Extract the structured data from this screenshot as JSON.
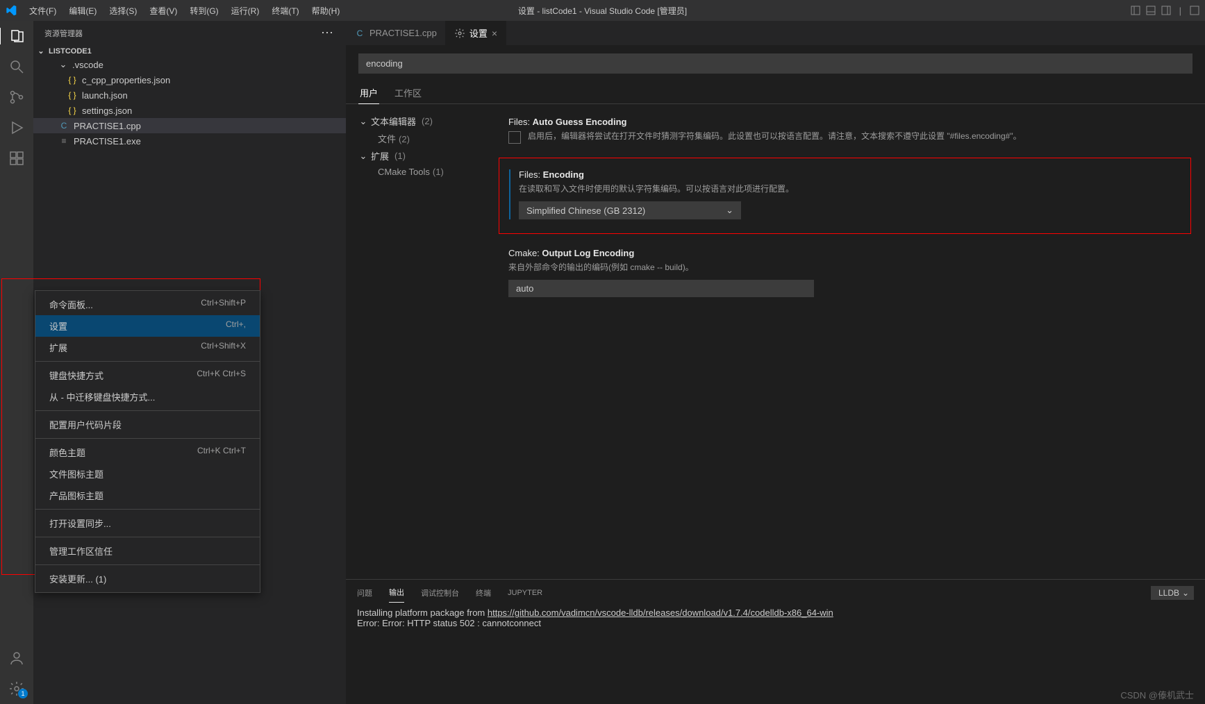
{
  "window": {
    "title": "设置 - listCode1 - Visual Studio Code [管理员]"
  },
  "menus": [
    "文件(F)",
    "编辑(E)",
    "选择(S)",
    "查看(V)",
    "转到(G)",
    "运行(R)",
    "终端(T)",
    "帮助(H)"
  ],
  "sidebar": {
    "title": "资源管理器",
    "project": "LISTCODE1",
    "tree": [
      {
        "label": ".vscode",
        "type": "folder",
        "depth": 1
      },
      {
        "label": "c_cpp_properties.json",
        "type": "json",
        "depth": 2
      },
      {
        "label": "launch.json",
        "type": "json",
        "depth": 2
      },
      {
        "label": "settings.json",
        "type": "json",
        "depth": 2
      },
      {
        "label": "PRACTISE1.cpp",
        "type": "cpp",
        "depth": 1,
        "selected": true
      },
      {
        "label": "PRACTISE1.exe",
        "type": "exe",
        "depth": 1
      }
    ]
  },
  "context_menu": [
    {
      "label": "命令面板...",
      "shortcut": "Ctrl+Shift+P"
    },
    {
      "label": "设置",
      "shortcut": "Ctrl+,",
      "hovered": true
    },
    {
      "label": "扩展",
      "shortcut": "Ctrl+Shift+X"
    },
    {
      "sep": true
    },
    {
      "label": "键盘快捷方式",
      "shortcut": "Ctrl+K Ctrl+S"
    },
    {
      "label": "从 - 中迁移键盘快捷方式..."
    },
    {
      "sep": true
    },
    {
      "label": "配置用户代码片段"
    },
    {
      "sep": true
    },
    {
      "label": "颜色主题",
      "shortcut": "Ctrl+K Ctrl+T"
    },
    {
      "label": "文件图标主题"
    },
    {
      "label": "产品图标主题"
    },
    {
      "sep": true
    },
    {
      "label": "打开设置同步..."
    },
    {
      "sep": true
    },
    {
      "label": "管理工作区信任"
    },
    {
      "sep": true
    },
    {
      "label": "安装更新... (1)"
    }
  ],
  "tabs": [
    {
      "icon": "cpp",
      "label": "PRACTISE1.cpp"
    },
    {
      "icon": "gear",
      "label": "设置",
      "active": true,
      "closable": true
    }
  ],
  "settings": {
    "search_value": "encoding",
    "scopes": {
      "user": "用户",
      "workspace": "工作区"
    },
    "toc": {
      "textEditor": {
        "label": "文本编辑器",
        "count": "(2)"
      },
      "files": {
        "label": "文件",
        "count": "(2)"
      },
      "extensions": {
        "label": "扩展",
        "count": "(1)"
      },
      "cmake": {
        "label": "CMake Tools",
        "count": "(1)"
      }
    },
    "items": {
      "autoGuess": {
        "prefix": "Files: ",
        "title": "Auto Guess Encoding",
        "desc": "启用后，编辑器将尝试在打开文件时猜测字符集编码。此设置也可以按语言配置。请注意，文本搜索不遵守此设置 \"#files.encoding#\"。"
      },
      "encoding": {
        "prefix": "Files: ",
        "title": "Encoding",
        "desc": "在读取和写入文件时使用的默认字符集编码。可以按语言对此项进行配置。",
        "value": "Simplified Chinese (GB 2312)"
      },
      "cmakeLog": {
        "prefix": "Cmake: ",
        "title": "Output Log Encoding",
        "desc": "来自外部命令的输出的编码(例如 cmake -- build)。",
        "value": "auto"
      }
    }
  },
  "panel": {
    "tabs": {
      "problems": "问题",
      "output": "输出",
      "debug": "调试控制台",
      "terminal": "终端",
      "jupyter": "JUPYTER"
    },
    "selector": "LLDB",
    "line1_a": "Installing platform package from ",
    "line1_url": "https://github.com/vadimcn/vscode-lldb/releases/download/v1.7.4/codelldb-x86_64-win",
    "line2": "Error: Error: HTTP status 502 : cannotconnect"
  },
  "watermark": "CSDN @傣机武士",
  "gear_badge": "1"
}
